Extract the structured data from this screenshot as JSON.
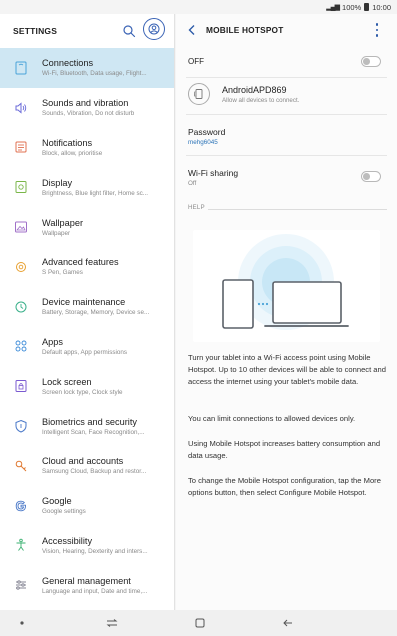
{
  "status_bar": {
    "battery": "100%",
    "time": "10:00"
  },
  "left_pane": {
    "title": "SETTINGS",
    "items": [
      {
        "icon": "connections-icon",
        "title": "Connections",
        "subtitle": "Wi-Fi, Bluetooth, Data usage, Flight...",
        "selected": true
      },
      {
        "icon": "sound-icon",
        "title": "Sounds and vibration",
        "subtitle": "Sounds, Vibration, Do not disturb"
      },
      {
        "icon": "notifications-icon",
        "title": "Notifications",
        "subtitle": "Block, allow, prioritise"
      },
      {
        "icon": "display-icon",
        "title": "Display",
        "subtitle": "Brightness, Blue light filter, Home sc..."
      },
      {
        "icon": "wallpaper-icon",
        "title": "Wallpaper",
        "subtitle": "Wallpaper"
      },
      {
        "icon": "advanced-features-icon",
        "title": "Advanced features",
        "subtitle": "S Pen, Games"
      },
      {
        "icon": "device-maintenance-icon",
        "title": "Device maintenance",
        "subtitle": "Battery, Storage, Memory, Device se..."
      },
      {
        "icon": "apps-icon",
        "title": "Apps",
        "subtitle": "Default apps, App permissions"
      },
      {
        "icon": "lock-screen-icon",
        "title": "Lock screen",
        "subtitle": "Screen lock type, Clock style"
      },
      {
        "icon": "biometrics-icon",
        "title": "Biometrics and security",
        "subtitle": "Intelligent Scan, Face Recognition,..."
      },
      {
        "icon": "cloud-accounts-icon",
        "title": "Cloud and accounts",
        "subtitle": "Samsung Cloud, Backup and restor..."
      },
      {
        "icon": "google-icon",
        "title": "Google",
        "subtitle": "Google settings"
      },
      {
        "icon": "accessibility-icon",
        "title": "Accessibility",
        "subtitle": "Vision, Hearing, Dexterity and inters..."
      },
      {
        "icon": "general-management-icon",
        "title": "General management",
        "subtitle": "Language and input, Date and time,..."
      }
    ]
  },
  "right_pane": {
    "title": "MOBILE HOTSPOT",
    "master_toggle": {
      "label": "OFF",
      "on": false
    },
    "device": {
      "name": "AndroidAPD869",
      "subtitle": "Allow all devices to connect."
    },
    "password": {
      "label": "Password",
      "value": "mehg6045"
    },
    "wifi_sharing": {
      "label": "Wi-Fi sharing",
      "value": "Off",
      "on": false
    },
    "help_label": "HELP",
    "help_paragraphs": [
      "Turn your tablet into a Wi-Fi access point using Mobile Hotspot. Up to 10 other devices will be able to connect and access the internet using your tablet's mobile data.",
      "You can limit connections to allowed devices only.",
      "Using Mobile Hotspot increases battery consumption and data usage.",
      "To change the Mobile Hotspot configuration, tap the More options button, then select Configure Mobile Hotspot."
    ]
  },
  "colors": {
    "accent": "#2c5aa8",
    "selected_bg": "#cfe7f3",
    "link": "#2c74b8"
  }
}
